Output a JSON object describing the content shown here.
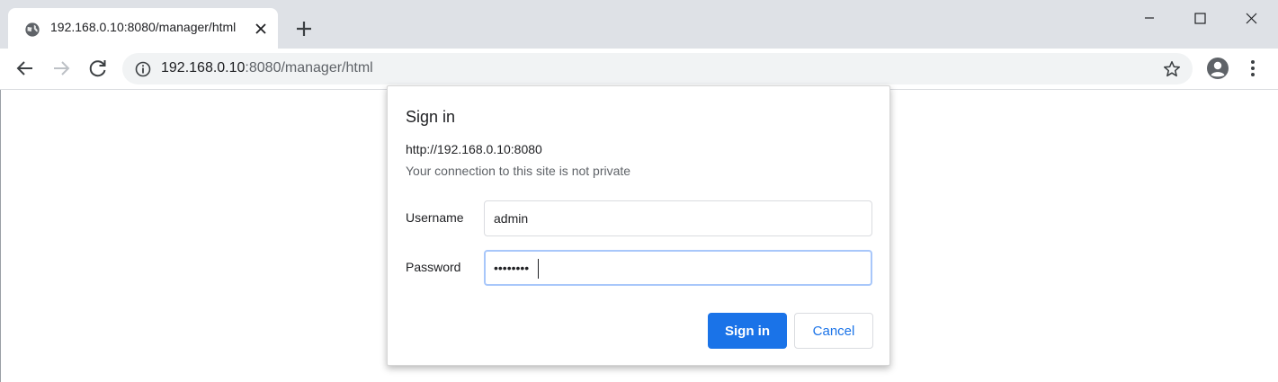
{
  "tab": {
    "title": "192.168.0.10:8080/manager/html",
    "favicon": "globe-icon"
  },
  "omnibox": {
    "host": "192.168.0.10",
    "rest": ":8080/manager/html"
  },
  "dialog": {
    "title": "Sign in",
    "origin": "http://192.168.0.10:8080",
    "warning": "Your connection to this site is not private",
    "username_label": "Username",
    "username_value": "admin",
    "password_label": "Password",
    "password_mask": "••••••••",
    "signin_label": "Sign in",
    "cancel_label": "Cancel"
  },
  "colors": {
    "accent": "#1a73e8",
    "tabstrip": "#dee1e6",
    "omnibox": "#f1f3f4"
  }
}
